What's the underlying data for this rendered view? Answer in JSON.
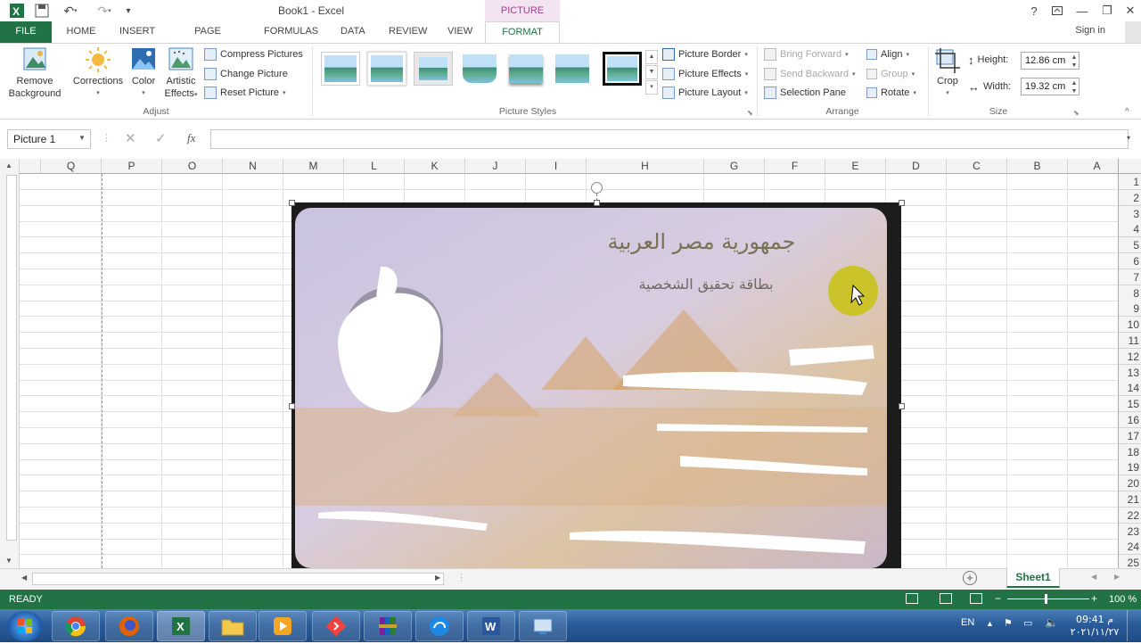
{
  "titlebar": {
    "title": "Book1 - Excel",
    "context_tab": "PICTURE TOOLS",
    "help": "?",
    "minimize": "—",
    "restore": "❐",
    "close": "✕"
  },
  "tabs": [
    "FILE",
    "HOME",
    "INSERT",
    "PAGE LAYOUT",
    "FORMULAS",
    "DATA",
    "REVIEW",
    "VIEW",
    "FORMAT"
  ],
  "signin": "Sign in",
  "ribbon": {
    "adjust": {
      "remove_background_1": "Remove",
      "remove_background_2": "Background",
      "corrections": "Corrections",
      "color": "Color",
      "artistic_1": "Artistic",
      "artistic_2": "Effects",
      "compress": "Compress Pictures",
      "change": "Change Picture",
      "reset": "Reset Picture",
      "label": "Adjust"
    },
    "styles": {
      "label": "Picture Styles"
    },
    "picture_opts": {
      "border": "Picture Border",
      "effects": "Picture Effects",
      "layout": "Picture Layout"
    },
    "arrange": {
      "bring_forward": "Bring Forward",
      "send_backward": "Send Backward",
      "selection_pane": "Selection Pane",
      "align": "Align",
      "group": "Group",
      "rotate": "Rotate",
      "label": "Arrange"
    },
    "size": {
      "crop": "Crop",
      "height_label": "Height:",
      "height_value": "12.86 cm",
      "width_label": "Width:",
      "width_value": "19.32 cm",
      "label": "Size"
    }
  },
  "formula_bar": {
    "name_box": "Picture 1",
    "fx": "fx",
    "value": ""
  },
  "columns": [
    "Q",
    "P",
    "O",
    "N",
    "M",
    "L",
    "K",
    "J",
    "I",
    "H",
    "G",
    "F",
    "E",
    "D",
    "C",
    "B",
    "A"
  ],
  "rows": [
    "1",
    "2",
    "3",
    "4",
    "5",
    "6",
    "7",
    "8",
    "9",
    "10",
    "11",
    "12",
    "13",
    "14",
    "15",
    "16",
    "17",
    "18",
    "19",
    "20",
    "21",
    "22",
    "23",
    "24",
    "25"
  ],
  "picture": {
    "arabic_line_1": "جمهورية مصر العربية",
    "arabic_line_2": "بطاقة تحقيق الشخصية"
  },
  "sheets": [
    "Sheet1"
  ],
  "status": {
    "mode": "READY",
    "zoom": "100 %"
  },
  "taskbar": {
    "lang": "EN",
    "time": "09:41 م",
    "date": "٢٠٢١/١١/٢٧"
  }
}
